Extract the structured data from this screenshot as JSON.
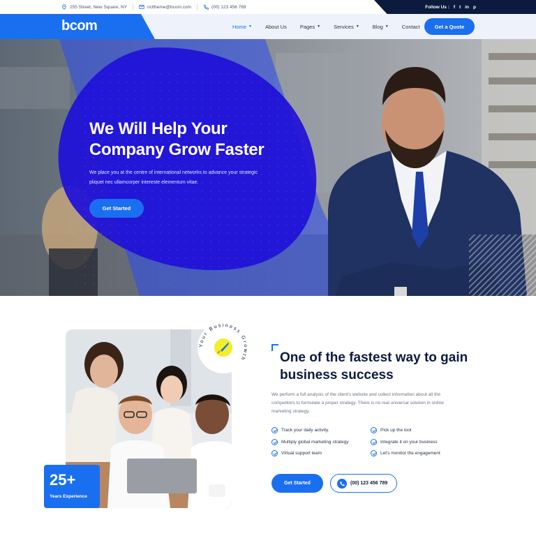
{
  "topbar": {
    "address": "255 Street, New Square, NY",
    "email": "ncltheme@bcom.com",
    "phone": "(00) 123 456 789",
    "follow_label": "Follow Us :",
    "social": [
      "f",
      "t",
      "in",
      "p"
    ]
  },
  "nav": {
    "logo": "bcom",
    "menu": [
      {
        "label": "Home",
        "has_caret": true,
        "active": true
      },
      {
        "label": "About Us",
        "has_caret": false,
        "active": false
      },
      {
        "label": "Pages",
        "has_caret": true,
        "active": false
      },
      {
        "label": "Services",
        "has_caret": true,
        "active": false
      },
      {
        "label": "Blog",
        "has_caret": true,
        "active": false
      },
      {
        "label": "Contact",
        "has_caret": false,
        "active": false
      }
    ],
    "cta": "Get a Quote"
  },
  "hero": {
    "title": "We Will Help Your Company Grow Faster",
    "text": "We place you at the centre of international networks to advance your strategic pliquet nec ullamcorper intereste elementum vitae.",
    "cta": "Get Started"
  },
  "about": {
    "experience_number": "25+",
    "experience_label": "Years Experience",
    "badge_text": "Your Business Growth",
    "title": "One of the fastest way to gain business success",
    "text": "We perform a full analysis of the client's website and collect information about all the competitors to formulate a proper strategy. There is no real universal solution in online marketing strategy.",
    "features": [
      "Track your daily activity.",
      "Pick up the tool",
      "Multiply global marketing strategy",
      "Integrate it on your business",
      "Virtual support team",
      "Let's monitor the engagement"
    ],
    "cta": "Get Started",
    "phone": "(00) 123 456 789"
  },
  "colors": {
    "accent": "#1a6ff0",
    "navy": "#0c1a3e",
    "hero_shape": "#1f10d8"
  }
}
